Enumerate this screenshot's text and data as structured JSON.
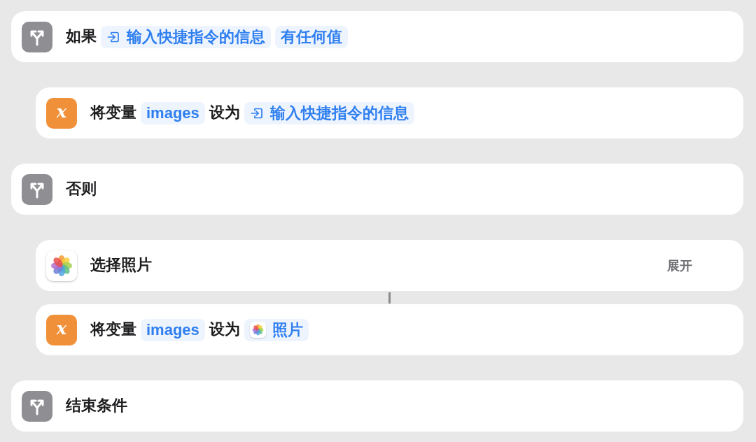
{
  "blocks": [
    {
      "kind": "condition",
      "parts": [
        {
          "kind": "text",
          "text": "如果"
        },
        {
          "kind": "input_token",
          "text": "输入快捷指令的信息"
        },
        {
          "kind": "token",
          "text": "有任何值"
        }
      ],
      "children": [
        {
          "kind": "set_variable",
          "glyph": "x",
          "connected": false,
          "parts": [
            {
              "kind": "text",
              "text": "将变量"
            },
            {
              "kind": "token",
              "text": "images"
            },
            {
              "kind": "text",
              "text": "设为"
            },
            {
              "kind": "input_token",
              "text": "输入快捷指令的信息"
            }
          ]
        }
      ]
    },
    {
      "kind": "condition",
      "parts": [
        {
          "kind": "text",
          "text": "否则"
        }
      ],
      "children": [
        {
          "kind": "select_photos",
          "connected": false,
          "parts": [
            {
              "kind": "text",
              "text": "选择照片"
            }
          ],
          "expand_button": "展开"
        },
        {
          "kind": "set_variable",
          "glyph": "x",
          "connected": true,
          "parts": [
            {
              "kind": "text",
              "text": "将变量"
            },
            {
              "kind": "token",
              "text": "images"
            },
            {
              "kind": "text",
              "text": "设为"
            },
            {
              "kind": "photos_token",
              "text": "照片"
            }
          ]
        }
      ]
    },
    {
      "kind": "condition",
      "parts": [
        {
          "kind": "text",
          "text": "结束条件"
        }
      ]
    }
  ]
}
